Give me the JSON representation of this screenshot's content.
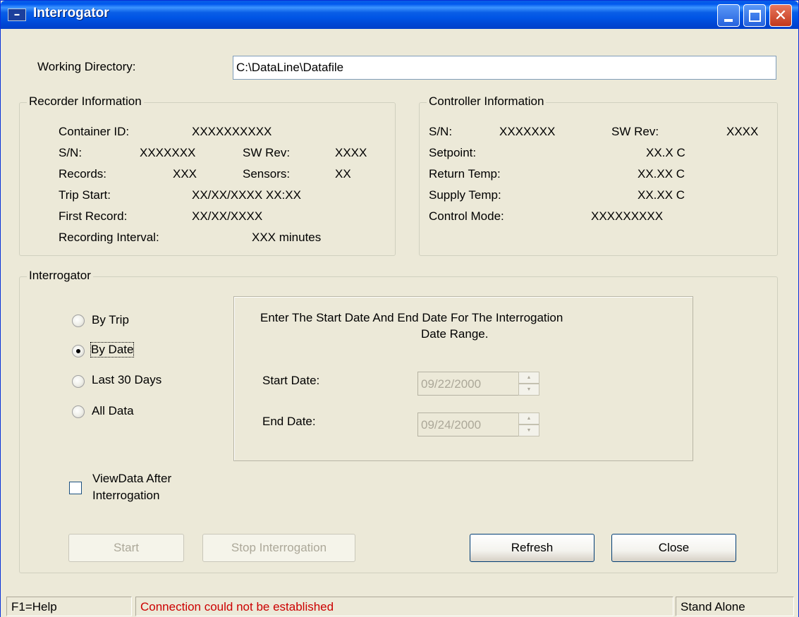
{
  "window": {
    "title": "Interrogator",
    "close_glyph": "✕"
  },
  "working_directory": {
    "label": "Working Directory:",
    "value": "C:\\DataLine\\Datafile"
  },
  "recorder": {
    "title": "Recorder Information",
    "container_id_label": "Container ID:",
    "container_id_value": "XXXXXXXXXX",
    "sn_label": "S/N:",
    "sn_value": "XXXXXXX",
    "swrev_label": "SW Rev:",
    "swrev_value": "XXXX",
    "records_label": "Records:",
    "records_value": "XXX",
    "sensors_label": "Sensors:",
    "sensors_value": "XX",
    "trip_start_label": "Trip Start:",
    "trip_start_value": "XX/XX/XXXX XX:XX",
    "first_record_label": "First Record:",
    "first_record_value": "XX/XX/XXXX",
    "interval_label": "Recording Interval:",
    "interval_value": "XXX minutes"
  },
  "controller": {
    "title": "Controller Information",
    "sn_label": "S/N:",
    "sn_value": "XXXXXXX",
    "swrev_label": "SW Rev:",
    "swrev_value": "XXXX",
    "setpoint_label": "Setpoint:",
    "setpoint_value": "XX.X  C",
    "return_label": "Return Temp:",
    "return_value": "XX.XX  C",
    "supply_label": "Supply Temp:",
    "supply_value": "XX.XX  C",
    "mode_label": "Control Mode:",
    "mode_value": "XXXXXXXXX"
  },
  "interrogator": {
    "title": "Interrogator",
    "options": [
      {
        "label": "By Trip",
        "checked": false
      },
      {
        "label": "By Date",
        "checked": true
      },
      {
        "label": "Last 30 Days",
        "checked": false
      },
      {
        "label": "All Data",
        "checked": false
      }
    ],
    "instructions_line1": "Enter The Start Date And End Date For The Interrogation",
    "instructions_line2": "Date Range.",
    "start_date_label": "Start Date:",
    "start_date_value": "09/22/2000",
    "end_date_label": "End Date:",
    "end_date_value": "09/24/2000",
    "view_after_line1": "ViewData After",
    "view_after_line2": "Interrogation",
    "view_after_checked": false
  },
  "buttons": {
    "start": "Start",
    "stop": "Stop Interrogation",
    "refresh": "Refresh",
    "close": "Close"
  },
  "status": {
    "help": "F1=Help",
    "message": "Connection could not be established",
    "mode": "Stand Alone",
    "message_color": "#cc0000"
  }
}
